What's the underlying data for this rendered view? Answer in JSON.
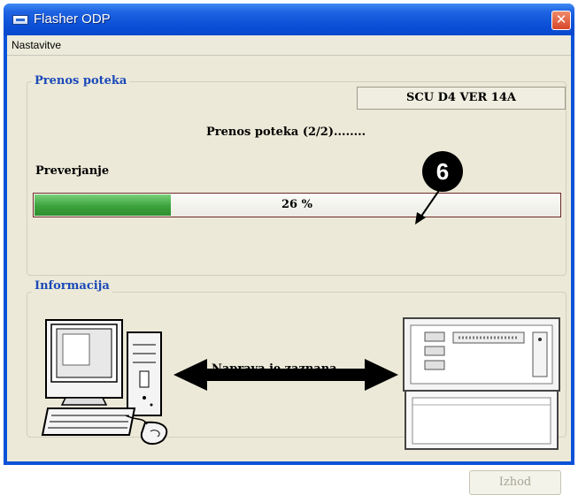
{
  "window": {
    "title": "Flasher ODP",
    "close_glyph": "✕"
  },
  "menu": {
    "items": [
      {
        "label": "Nastavitve"
      }
    ]
  },
  "transfer_group": {
    "title": "Prenos poteka",
    "version": "SCU D4 VER  14A",
    "status": "Prenos poteka (2/2)........",
    "verify_label": "Preverjanje",
    "progress_percent": 26,
    "progress_text": "26 %"
  },
  "info_group": {
    "title": "Informacija",
    "status": "Naprava je zaznana"
  },
  "callout": {
    "number": "6"
  },
  "buttons": {
    "exit_label": "Izhod"
  },
  "icons": {
    "app": "app-icon",
    "close": "close-icon",
    "computer": "computer-icon",
    "device": "device-icon",
    "arrow": "double-arrow-icon"
  },
  "colors": {
    "titlebar": "#0a52d8",
    "progress_fill": "#3ca23c",
    "group_title": "#1a49b8"
  }
}
